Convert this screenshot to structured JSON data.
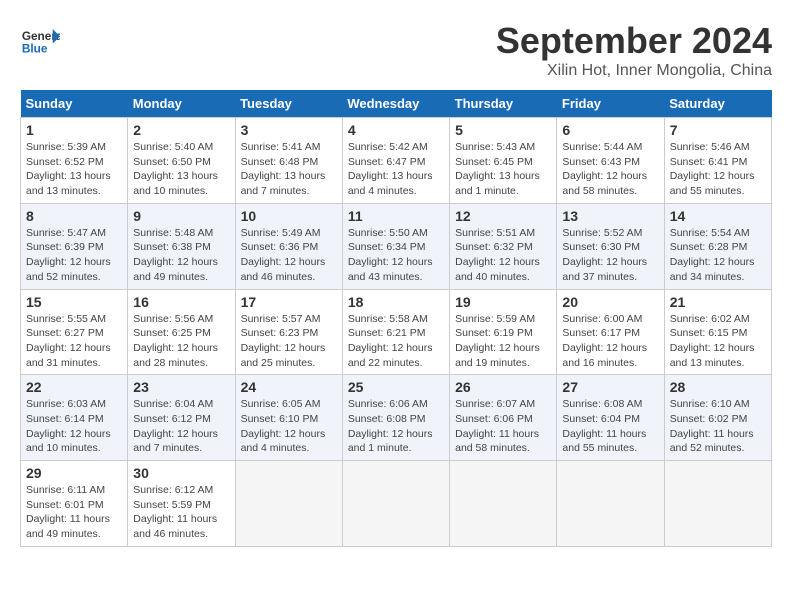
{
  "header": {
    "logo_general": "General",
    "logo_blue": "Blue",
    "title": "September 2024",
    "subtitle": "Xilin Hot, Inner Mongolia, China"
  },
  "calendar": {
    "days_of_week": [
      "Sunday",
      "Monday",
      "Tuesday",
      "Wednesday",
      "Thursday",
      "Friday",
      "Saturday"
    ],
    "weeks": [
      [
        {
          "num": "",
          "info": ""
        },
        {
          "num": "2",
          "info": "Sunrise: 5:40 AM\nSunset: 6:50 PM\nDaylight: 13 hours\nand 10 minutes."
        },
        {
          "num": "3",
          "info": "Sunrise: 5:41 AM\nSunset: 6:48 PM\nDaylight: 13 hours\nand 7 minutes."
        },
        {
          "num": "4",
          "info": "Sunrise: 5:42 AM\nSunset: 6:47 PM\nDaylight: 13 hours\nand 4 minutes."
        },
        {
          "num": "5",
          "info": "Sunrise: 5:43 AM\nSunset: 6:45 PM\nDaylight: 13 hours\nand 1 minute."
        },
        {
          "num": "6",
          "info": "Sunrise: 5:44 AM\nSunset: 6:43 PM\nDaylight: 12 hours\nand 58 minutes."
        },
        {
          "num": "7",
          "info": "Sunrise: 5:46 AM\nSunset: 6:41 PM\nDaylight: 12 hours\nand 55 minutes."
        }
      ],
      [
        {
          "num": "8",
          "info": "Sunrise: 5:47 AM\nSunset: 6:39 PM\nDaylight: 12 hours\nand 52 minutes."
        },
        {
          "num": "9",
          "info": "Sunrise: 5:48 AM\nSunset: 6:38 PM\nDaylight: 12 hours\nand 49 minutes."
        },
        {
          "num": "10",
          "info": "Sunrise: 5:49 AM\nSunset: 6:36 PM\nDaylight: 12 hours\nand 46 minutes."
        },
        {
          "num": "11",
          "info": "Sunrise: 5:50 AM\nSunset: 6:34 PM\nDaylight: 12 hours\nand 43 minutes."
        },
        {
          "num": "12",
          "info": "Sunrise: 5:51 AM\nSunset: 6:32 PM\nDaylight: 12 hours\nand 40 minutes."
        },
        {
          "num": "13",
          "info": "Sunrise: 5:52 AM\nSunset: 6:30 PM\nDaylight: 12 hours\nand 37 minutes."
        },
        {
          "num": "14",
          "info": "Sunrise: 5:54 AM\nSunset: 6:28 PM\nDaylight: 12 hours\nand 34 minutes."
        }
      ],
      [
        {
          "num": "15",
          "info": "Sunrise: 5:55 AM\nSunset: 6:27 PM\nDaylight: 12 hours\nand 31 minutes."
        },
        {
          "num": "16",
          "info": "Sunrise: 5:56 AM\nSunset: 6:25 PM\nDaylight: 12 hours\nand 28 minutes."
        },
        {
          "num": "17",
          "info": "Sunrise: 5:57 AM\nSunset: 6:23 PM\nDaylight: 12 hours\nand 25 minutes."
        },
        {
          "num": "18",
          "info": "Sunrise: 5:58 AM\nSunset: 6:21 PM\nDaylight: 12 hours\nand 22 minutes."
        },
        {
          "num": "19",
          "info": "Sunrise: 5:59 AM\nSunset: 6:19 PM\nDaylight: 12 hours\nand 19 minutes."
        },
        {
          "num": "20",
          "info": "Sunrise: 6:00 AM\nSunset: 6:17 PM\nDaylight: 12 hours\nand 16 minutes."
        },
        {
          "num": "21",
          "info": "Sunrise: 6:02 AM\nSunset: 6:15 PM\nDaylight: 12 hours\nand 13 minutes."
        }
      ],
      [
        {
          "num": "22",
          "info": "Sunrise: 6:03 AM\nSunset: 6:14 PM\nDaylight: 12 hours\nand 10 minutes."
        },
        {
          "num": "23",
          "info": "Sunrise: 6:04 AM\nSunset: 6:12 PM\nDaylight: 12 hours\nand 7 minutes."
        },
        {
          "num": "24",
          "info": "Sunrise: 6:05 AM\nSunset: 6:10 PM\nDaylight: 12 hours\nand 4 minutes."
        },
        {
          "num": "25",
          "info": "Sunrise: 6:06 AM\nSunset: 6:08 PM\nDaylight: 12 hours\nand 1 minute."
        },
        {
          "num": "26",
          "info": "Sunrise: 6:07 AM\nSunset: 6:06 PM\nDaylight: 11 hours\nand 58 minutes."
        },
        {
          "num": "27",
          "info": "Sunrise: 6:08 AM\nSunset: 6:04 PM\nDaylight: 11 hours\nand 55 minutes."
        },
        {
          "num": "28",
          "info": "Sunrise: 6:10 AM\nSunset: 6:02 PM\nDaylight: 11 hours\nand 52 minutes."
        }
      ],
      [
        {
          "num": "29",
          "info": "Sunrise: 6:11 AM\nSunset: 6:01 PM\nDaylight: 11 hours\nand 49 minutes."
        },
        {
          "num": "30",
          "info": "Sunrise: 6:12 AM\nSunset: 5:59 PM\nDaylight: 11 hours\nand 46 minutes."
        },
        {
          "num": "",
          "info": ""
        },
        {
          "num": "",
          "info": ""
        },
        {
          "num": "",
          "info": ""
        },
        {
          "num": "",
          "info": ""
        },
        {
          "num": "",
          "info": ""
        }
      ]
    ],
    "first_row": [
      {
        "num": "1",
        "info": "Sunrise: 5:39 AM\nSunset: 6:52 PM\nDaylight: 13 hours\nand 13 minutes."
      }
    ]
  }
}
